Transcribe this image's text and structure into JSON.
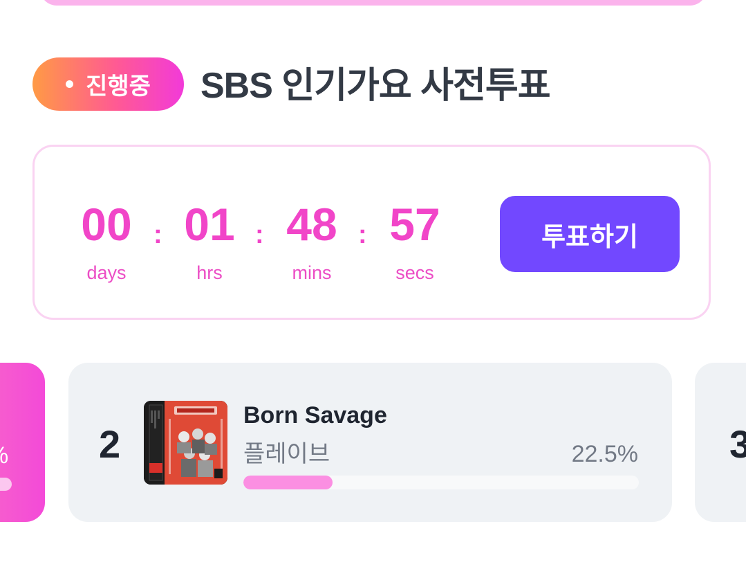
{
  "status_badge": {
    "label": "진행중"
  },
  "vote_title": "SBS 인기가요 사전투표",
  "countdown": {
    "units": [
      {
        "value": "00",
        "label": "days"
      },
      {
        "value": "01",
        "label": "hrs"
      },
      {
        "value": "48",
        "label": "mins"
      },
      {
        "value": "57",
        "label": "secs"
      }
    ],
    "separator": ":"
  },
  "vote_button": {
    "label": "투표하기"
  },
  "rankings": {
    "previous_card": {
      "percent_fragment": "%"
    },
    "current_card": {
      "rank": "2",
      "song_title": "Born Savage",
      "artist": "플레이브",
      "percent": "22.5%",
      "percent_value": 22.5
    },
    "next_card": {
      "rank": "3"
    }
  },
  "colors": {
    "accent_pink": "#f145c8",
    "vote_button": "#7248ff",
    "progress_fill": "#fb8fe2"
  },
  "icons": {
    "status_dot": "live-dot-icon",
    "album_art": "album-cover-image"
  }
}
